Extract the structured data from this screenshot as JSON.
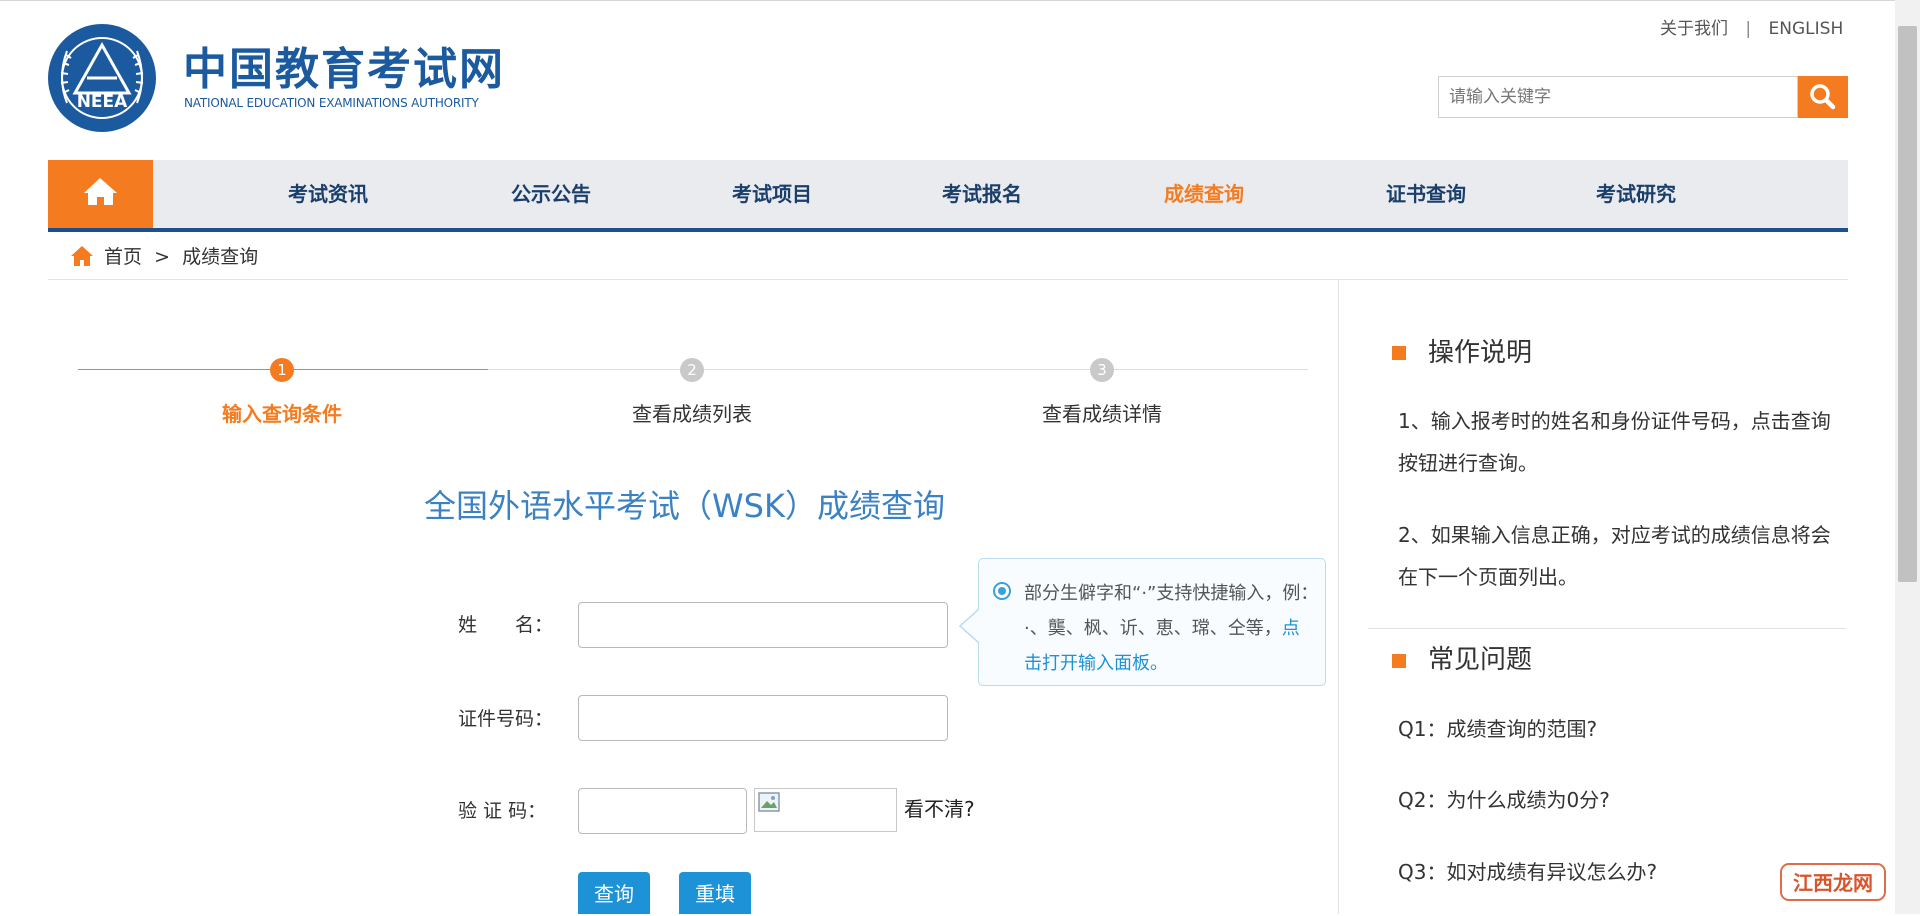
{
  "header": {
    "site_title": "中国教育考试网",
    "site_subtitle": "NATIONAL EDUCATION EXAMINATIONS AUTHORITY",
    "logo_text": "NEEA",
    "links": {
      "about": "关于我们",
      "separator": "|",
      "english": "ENGLISH"
    },
    "search": {
      "placeholder": "请输入关键字"
    }
  },
  "nav": {
    "items": [
      {
        "label": "考试资讯"
      },
      {
        "label": "公示公告"
      },
      {
        "label": "考试项目"
      },
      {
        "label": "考试报名"
      },
      {
        "label": "成绩查询",
        "active": true
      },
      {
        "label": "证书查询"
      },
      {
        "label": "考试研究"
      }
    ]
  },
  "breadcrumb": {
    "home": "首页",
    "separator": ">",
    "current": "成绩查询"
  },
  "steps": [
    {
      "number": "1",
      "label": "输入查询条件",
      "active": true
    },
    {
      "number": "2",
      "label": "查看成绩列表",
      "active": false
    },
    {
      "number": "3",
      "label": "查看成绩详情",
      "active": false
    }
  ],
  "form": {
    "title": "全国外语水平考试（WSK）成绩查询",
    "name_label": "姓　　名：",
    "id_label": "证件号码：",
    "captcha_label": "验 证 码：",
    "captcha_refresh": "看不清?",
    "submit": "查询",
    "reset": "重填"
  },
  "tooltip": {
    "text": "部分生僻字和“·”支持快捷输入，例：·、龑、枫、䜣、恵、瑺、仝等，",
    "link": "点击打开输入面板。"
  },
  "sidebar": {
    "instructions_title": "操作说明",
    "instructions": [
      "1、输入报考时的姓名和身份证件号码，点击查询按钮进行查询。",
      "2、如果输入信息正确，对应考试的成绩信息将会在下一个页面列出。"
    ],
    "faq_title": "常见问题",
    "faq": [
      "Q1：成绩查询的范围?",
      "Q2：为什么成绩为0分?",
      "Q3：如对成绩有异议怎么办?"
    ]
  },
  "watermark": "江西龙网",
  "colors": {
    "accent": "#f47b1f",
    "brand": "#1b5a9e",
    "nav_border": "#1b4f8f",
    "button": "#1d92d6"
  }
}
